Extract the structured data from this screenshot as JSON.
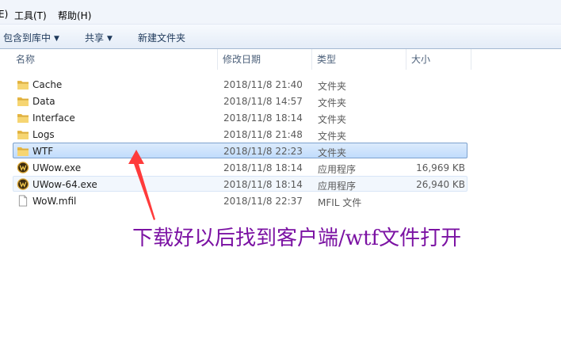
{
  "menubar": {
    "items": [
      {
        "label": "E)"
      },
      {
        "label": "工具(T)"
      },
      {
        "label": "帮助(H)"
      }
    ]
  },
  "toolbar": {
    "include_label": "包含到库中",
    "share_label": "共享",
    "new_folder_label": "新建文件夹"
  },
  "columns": {
    "name": "名称",
    "date": "修改日期",
    "type": "类型",
    "size": "大小"
  },
  "files": [
    {
      "name": "Cache",
      "date": "2018/11/8 21:40",
      "type": "文件夹",
      "size": "",
      "icon": "folder-icon"
    },
    {
      "name": "Data",
      "date": "2018/11/8 14:57",
      "type": "文件夹",
      "size": "",
      "icon": "folder-icon"
    },
    {
      "name": "Interface",
      "date": "2018/11/8 18:14",
      "type": "文件夹",
      "size": "",
      "icon": "folder-icon"
    },
    {
      "name": "Logs",
      "date": "2018/11/8 21:48",
      "type": "文件夹",
      "size": "",
      "icon": "folder-icon"
    },
    {
      "name": "WTF",
      "date": "2018/11/8 22:23",
      "type": "文件夹",
      "size": "",
      "icon": "folder-icon"
    },
    {
      "name": "UWow.exe",
      "date": "2018/11/8 18:14",
      "type": "应用程序",
      "size": "16,969 KB",
      "icon": "wow-app-icon"
    },
    {
      "name": "UWow-64.exe",
      "date": "2018/11/8 18:14",
      "type": "应用程序",
      "size": "26,940 KB",
      "icon": "wow-app-icon"
    },
    {
      "name": "WoW.mfil",
      "date": "2018/11/8 22:37",
      "type": "MFIL 文件",
      "size": "",
      "icon": "file-icon"
    }
  ],
  "annotation": {
    "text": "下载好以后找到客户端/wtf文件打开",
    "color": "#7b12a3"
  },
  "colors": {
    "selection": "#c1dcfc",
    "selection_border": "#7da2ce",
    "arrow": "#ff3b3b"
  }
}
